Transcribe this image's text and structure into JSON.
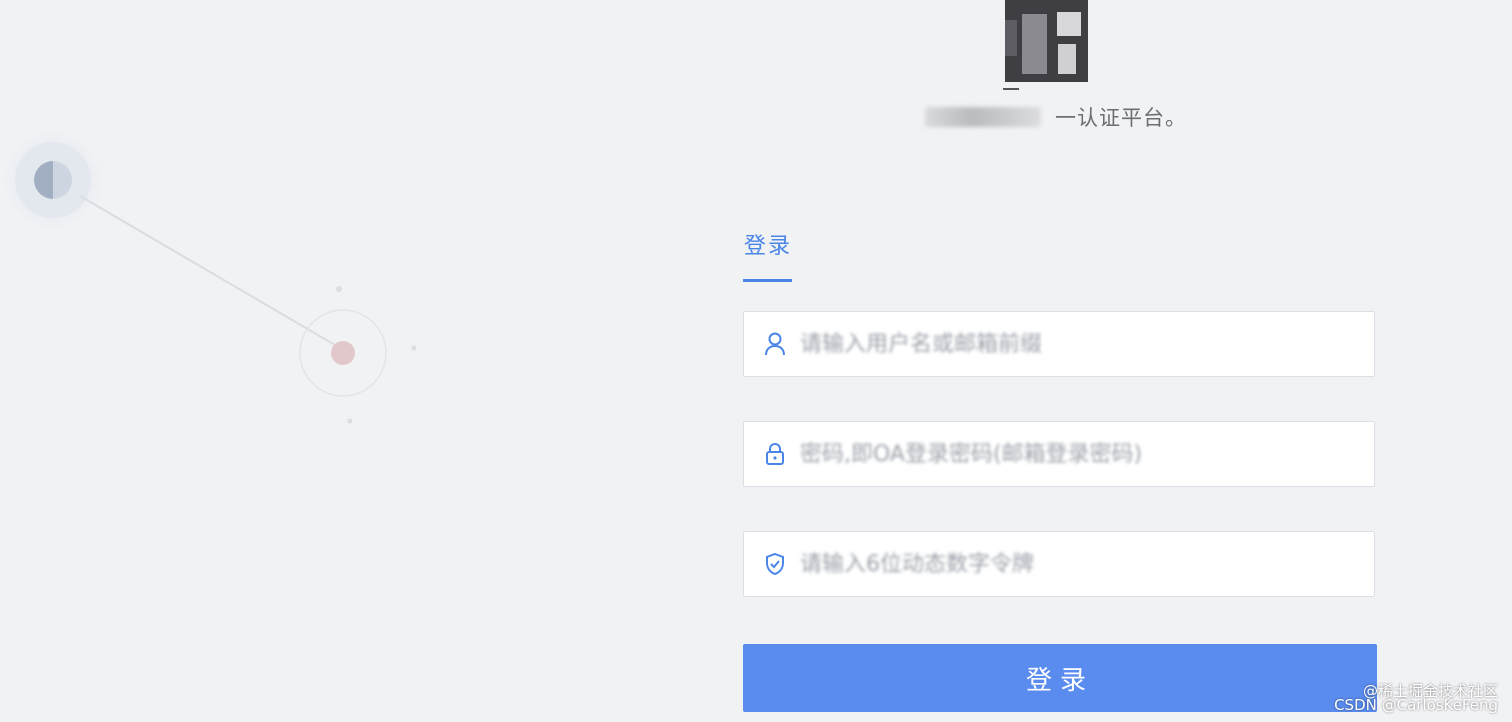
{
  "header": {
    "subtitle_visible": "一认证平台。"
  },
  "login": {
    "tab_label": "登录",
    "username": {
      "placeholder": "请输入用户名或邮箱前缀"
    },
    "password": {
      "placeholder": "密码,即OA登录密码(邮箱登录密码)"
    },
    "token": {
      "placeholder": "请输入6位动态数字令牌"
    },
    "submit_label": "登录"
  },
  "watermarks": {
    "community": "@稀土掘金技术社区",
    "author": "CSDN @CarlosKeFeng"
  },
  "colors": {
    "background": "#f1f2f4",
    "accent": "#4a86e8",
    "button": "#5a8cef"
  },
  "icons": {
    "username": "user-icon",
    "password": "lock-icon",
    "token": "shield-check-icon"
  }
}
